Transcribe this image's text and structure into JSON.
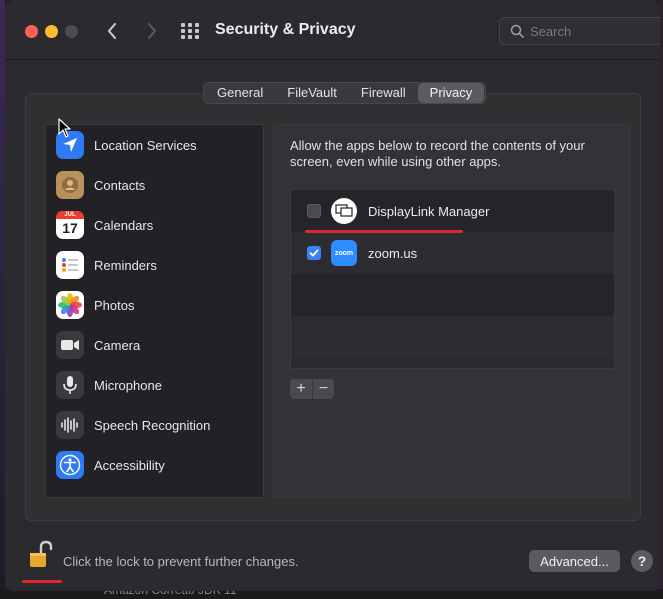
{
  "window": {
    "title": "Security & Privacy"
  },
  "search": {
    "placeholder": "Search"
  },
  "tabs": [
    {
      "label": "General",
      "active": false
    },
    {
      "label": "FileVault",
      "active": false
    },
    {
      "label": "Firewall",
      "active": false
    },
    {
      "label": "Privacy",
      "active": true
    }
  ],
  "sidebar": {
    "items": [
      {
        "label": "Location Services",
        "icon": "location-arrow-icon"
      },
      {
        "label": "Contacts",
        "icon": "contacts-icon"
      },
      {
        "label": "Calendars",
        "icon": "calendar-icon",
        "icon_month": "JUL",
        "icon_day": "17"
      },
      {
        "label": "Reminders",
        "icon": "reminders-icon"
      },
      {
        "label": "Photos",
        "icon": "photos-icon"
      },
      {
        "label": "Camera",
        "icon": "camera-icon"
      },
      {
        "label": "Microphone",
        "icon": "microphone-icon"
      },
      {
        "label": "Speech Recognition",
        "icon": "waveform-icon"
      },
      {
        "label": "Accessibility",
        "icon": "accessibility-icon"
      }
    ]
  },
  "privacy": {
    "description": "Allow the apps below to record the contents of your screen, even while using other apps.",
    "apps": [
      {
        "name": "DisplayLink Manager",
        "checked": false,
        "icon": "displaylink-icon"
      },
      {
        "name": "zoom.us",
        "checked": true,
        "icon": "zoom-icon",
        "icon_text": "zoom"
      }
    ],
    "add_label": "+",
    "remove_label": "−"
  },
  "footer": {
    "lock_text": "Click the lock to prevent further changes.",
    "advanced_label": "Advanced...",
    "help_label": "?"
  },
  "background": {
    "behind_window_text": "Amazon Corretto JDK 11"
  },
  "colors": {
    "accent_blue": "#3b82f6",
    "annotation_red": "#e0242c",
    "lock_gold": "#e6a82b"
  }
}
